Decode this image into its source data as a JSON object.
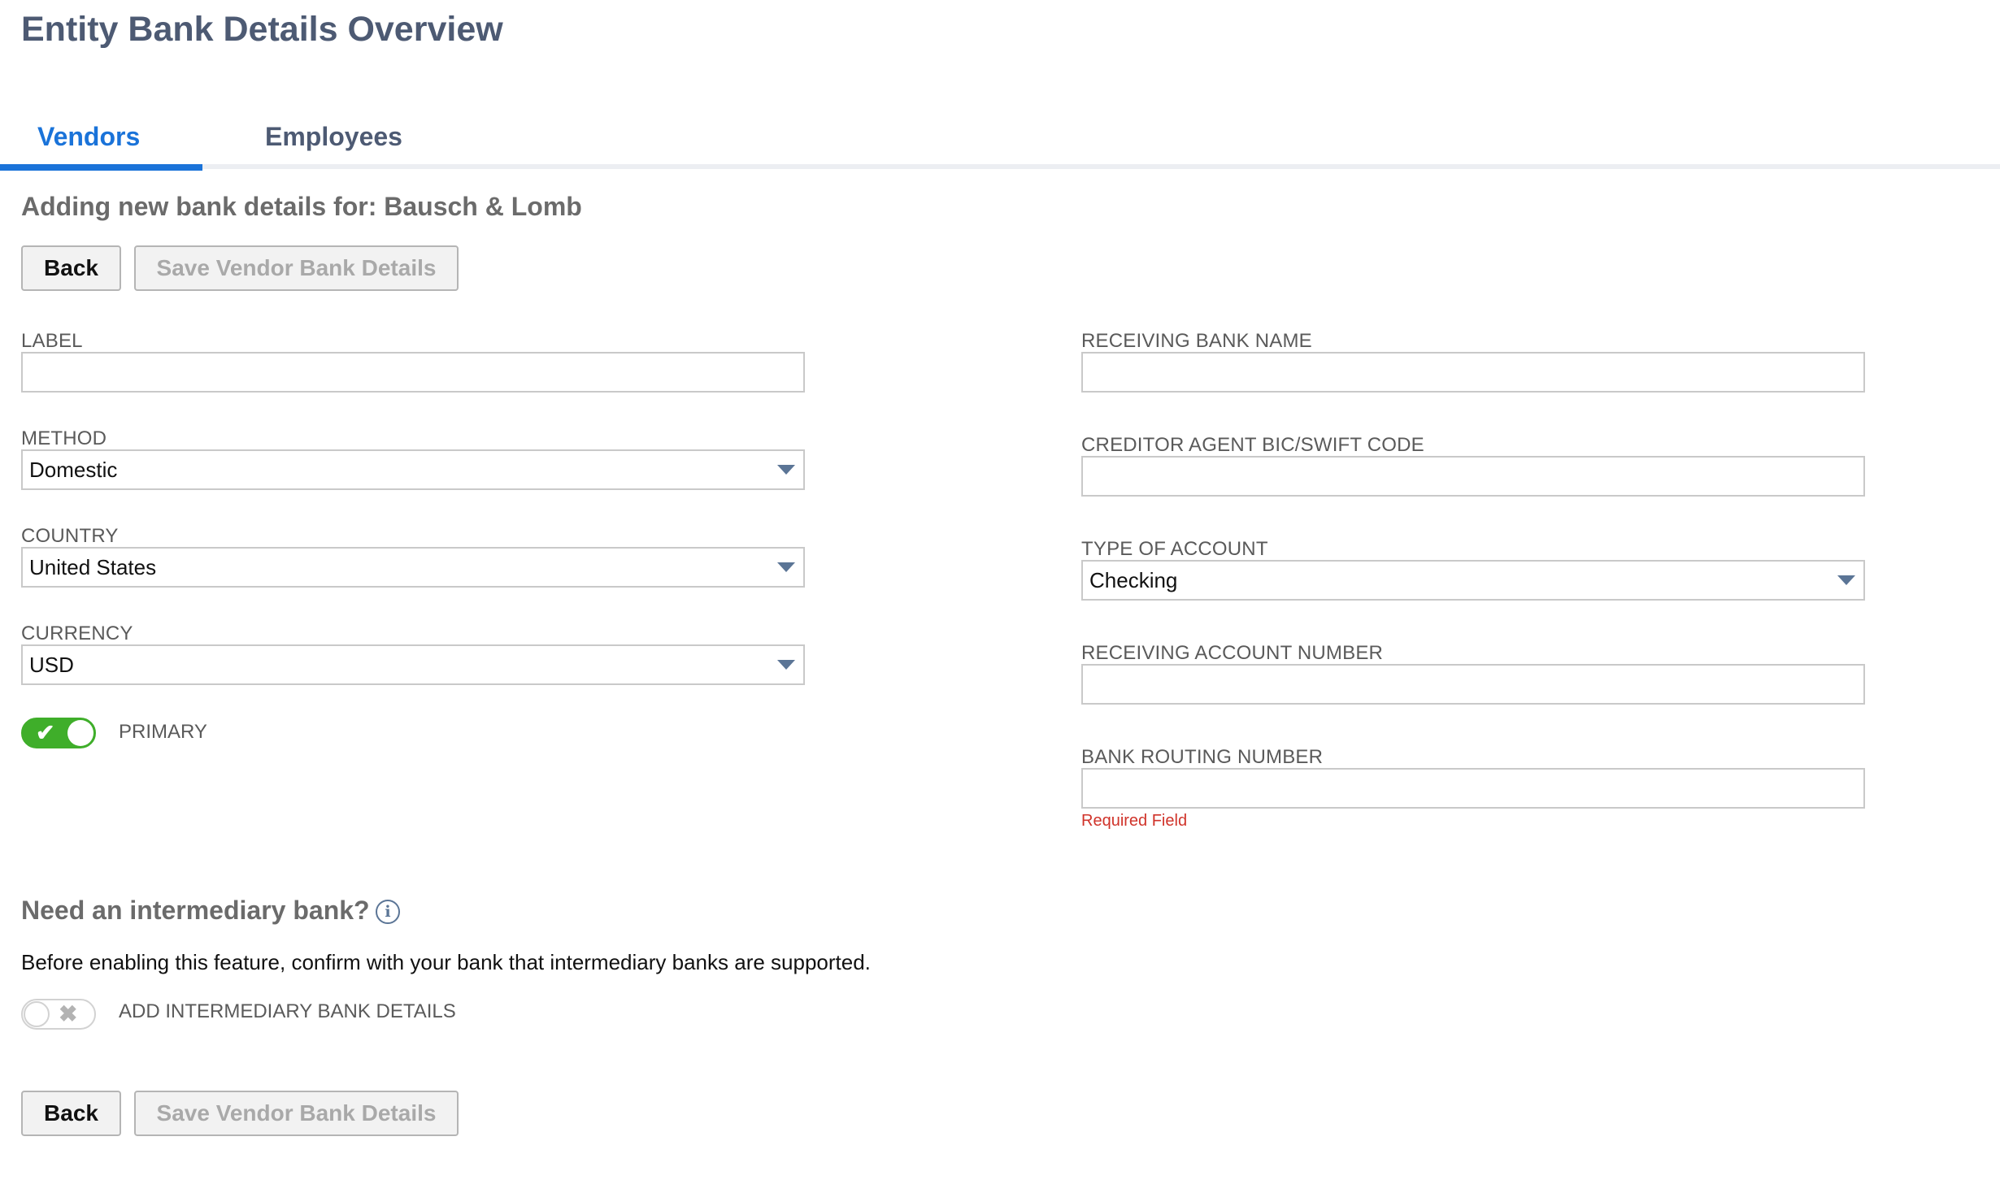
{
  "page": {
    "title": "Entity Bank Details Overview"
  },
  "tabs": [
    {
      "label": "Vendors",
      "active": true
    },
    {
      "label": "Employees",
      "active": false
    }
  ],
  "form": {
    "heading": "Adding new bank details for: Bausch & Lomb",
    "back_label": "Back",
    "save_label": "Save Vendor Bank Details",
    "left": {
      "label": {
        "label": "LABEL",
        "value": ""
      },
      "method": {
        "label": "METHOD",
        "value": "Domestic"
      },
      "country": {
        "label": "COUNTRY",
        "value": "United States"
      },
      "currency": {
        "label": "CURRENCY",
        "value": "USD"
      },
      "primary": {
        "label": "PRIMARY",
        "on": true
      }
    },
    "right": {
      "receiving_bank_name": {
        "label": "RECEIVING BANK NAME",
        "value": ""
      },
      "creditor_agent_bic": {
        "label": "CREDITOR AGENT BIC/SWIFT CODE",
        "value": ""
      },
      "type_of_account": {
        "label": "TYPE OF ACCOUNT",
        "value": "Checking"
      },
      "receiving_account_number": {
        "label": "RECEIVING ACCOUNT NUMBER",
        "value": ""
      },
      "bank_routing_number": {
        "label": "BANK ROUTING NUMBER",
        "value": "",
        "error": "Required Field"
      }
    },
    "intermediary": {
      "heading": "Need an intermediary bank?",
      "info_icon": "i",
      "note": "Before enabling this feature, confirm with your bank that intermediary banks are supported.",
      "toggle_label": "ADD INTERMEDIARY BANK DETAILS",
      "on": false
    }
  },
  "icons": {
    "toggle_on_glyph": "✔",
    "toggle_off_glyph": "✖"
  },
  "colors": {
    "accent": "#1a73d9",
    "title": "#4d5a73",
    "toggle_on": "#3fae2a",
    "error": "#d0332a"
  }
}
